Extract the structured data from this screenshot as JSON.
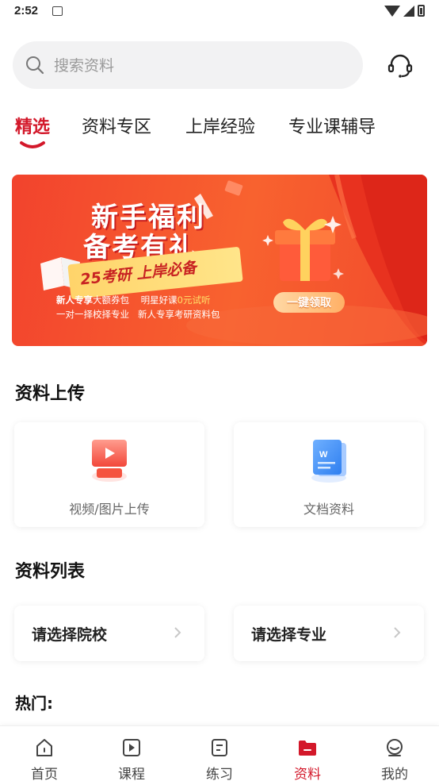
{
  "status_bar": {
    "time": "2:52"
  },
  "search": {
    "placeholder": "搜索资料",
    "icon": "search-icon",
    "support_icon": "headset-icon"
  },
  "tabs": [
    {
      "label": "精选",
      "active": true
    },
    {
      "label": "资料专区",
      "active": false
    },
    {
      "label": "上岸经验",
      "active": false
    },
    {
      "label": "专业课辅导",
      "active": false
    }
  ],
  "banner": {
    "title_line1": "新手福利",
    "title_line2": "备考有礼",
    "ribbon": "25考研 上岸必备",
    "line1_part1": "新人专享",
    "line1_part2": "大额券包",
    "line1_part3": "明星好课",
    "line1_part4": "0元试听",
    "line2_part1": "一对一择校择专业",
    "line2_part2": "新人专享考研资料包",
    "button": "一键领取"
  },
  "upload_section": {
    "title": "资料上传",
    "cards": [
      {
        "label": "视频/图片上传",
        "icon": "video-upload-icon"
      },
      {
        "label": "文档资料",
        "icon": "document-icon"
      }
    ]
  },
  "list_section": {
    "title": "资料列表",
    "selects": [
      {
        "label": "请选择院校"
      },
      {
        "label": "请选择专业"
      }
    ]
  },
  "hot": {
    "label": "热门:"
  },
  "bottom_nav": [
    {
      "label": "首页",
      "icon": "home-icon",
      "active": false
    },
    {
      "label": "课程",
      "icon": "play-icon",
      "active": false
    },
    {
      "label": "练习",
      "icon": "exercise-icon",
      "active": false
    },
    {
      "label": "资料",
      "icon": "folder-icon",
      "active": true
    },
    {
      "label": "我的",
      "icon": "profile-icon",
      "active": false
    }
  ],
  "colors": {
    "accent": "#d3182a",
    "banner_bg": "#f4522e",
    "search_bg": "#f2f2f3"
  }
}
